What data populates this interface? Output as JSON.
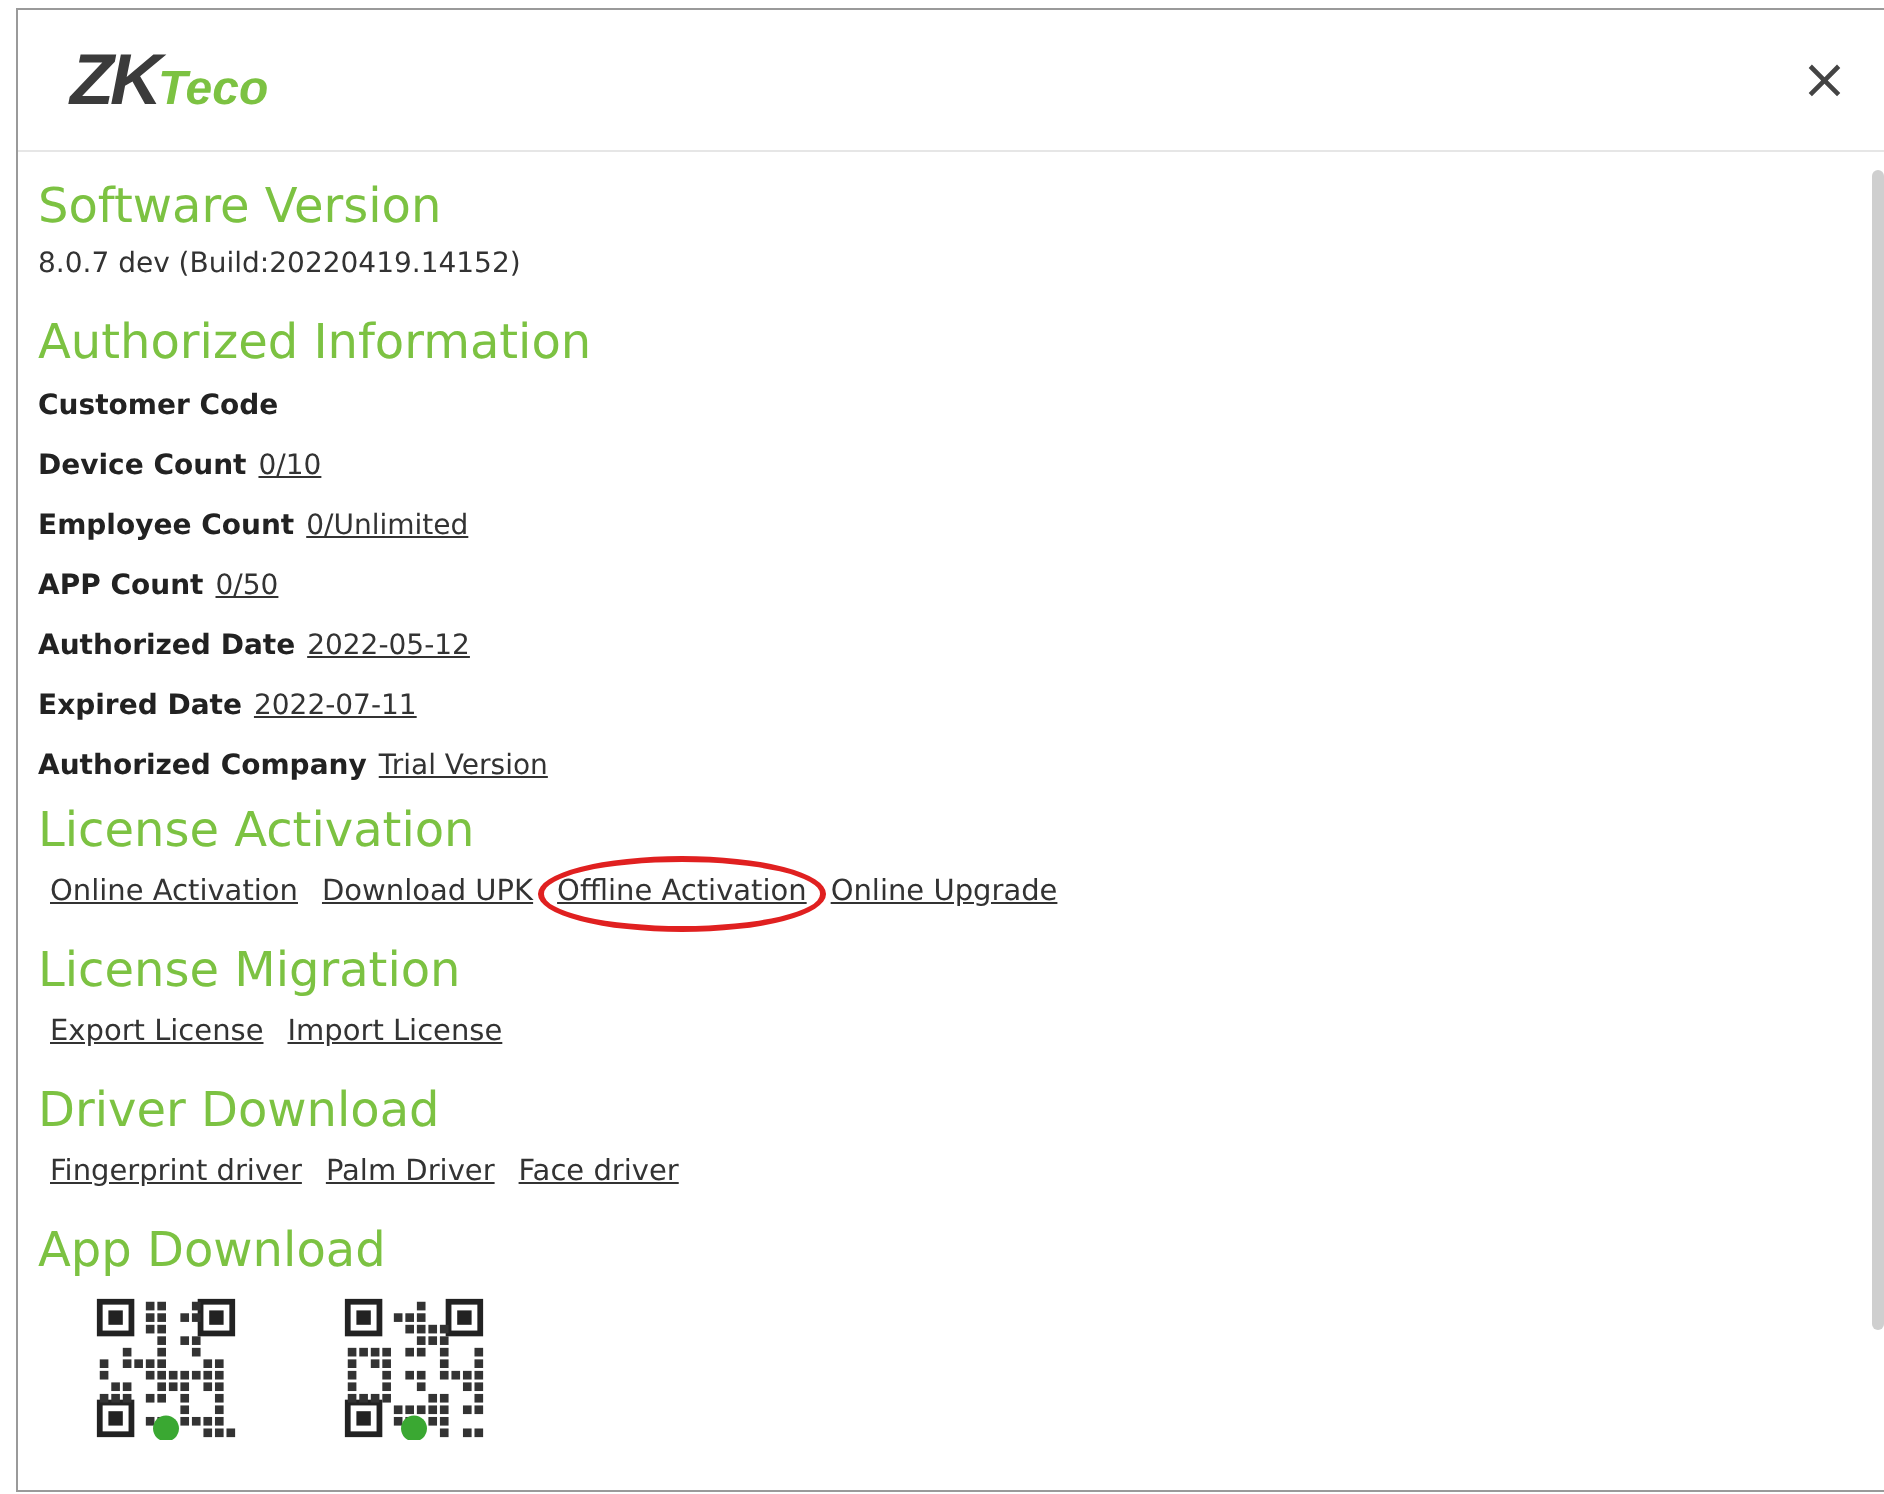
{
  "header": {
    "logo": {
      "dark": "ZK",
      "light": "Teco"
    },
    "close": "×"
  },
  "software_version": {
    "heading": "Software Version",
    "value": "8.0.7 dev (Build:20220419.14152)"
  },
  "authorized_information": {
    "heading": "Authorized Information",
    "rows": [
      {
        "label": "Customer Code"
      },
      {
        "label": "Device Count",
        "value": "0/10"
      },
      {
        "label": "Employee Count",
        "value": "0/Unlimited"
      },
      {
        "label": "APP Count",
        "value": "0/50"
      },
      {
        "label": "Authorized Date",
        "value": "2022-05-12"
      },
      {
        "label": "Expired Date",
        "value": "2022-07-11"
      },
      {
        "label": "Authorized Company",
        "value": "Trial Version"
      }
    ]
  },
  "link_sections": [
    {
      "heading": "License Activation",
      "links": [
        {
          "label": "Online Activation",
          "circled": false
        },
        {
          "label": "Download UPK",
          "circled": false
        },
        {
          "label": "Offline Activation",
          "circled": true
        },
        {
          "label": "Online Upgrade",
          "circled": false
        }
      ]
    },
    {
      "heading": "License Migration",
      "links": [
        {
          "label": "Export License",
          "circled": false
        },
        {
          "label": "Import License",
          "circled": false
        }
      ]
    },
    {
      "heading": "Driver Download",
      "links": [
        {
          "label": "Fingerprint driver",
          "circled": false
        },
        {
          "label": "Palm Driver",
          "circled": false
        },
        {
          "label": "Face driver",
          "circled": false
        }
      ]
    }
  ],
  "app_download": {
    "heading": "App Download",
    "qr_codes": [
      {
        "kind": "qr"
      },
      {
        "kind": "qr"
      }
    ]
  }
}
